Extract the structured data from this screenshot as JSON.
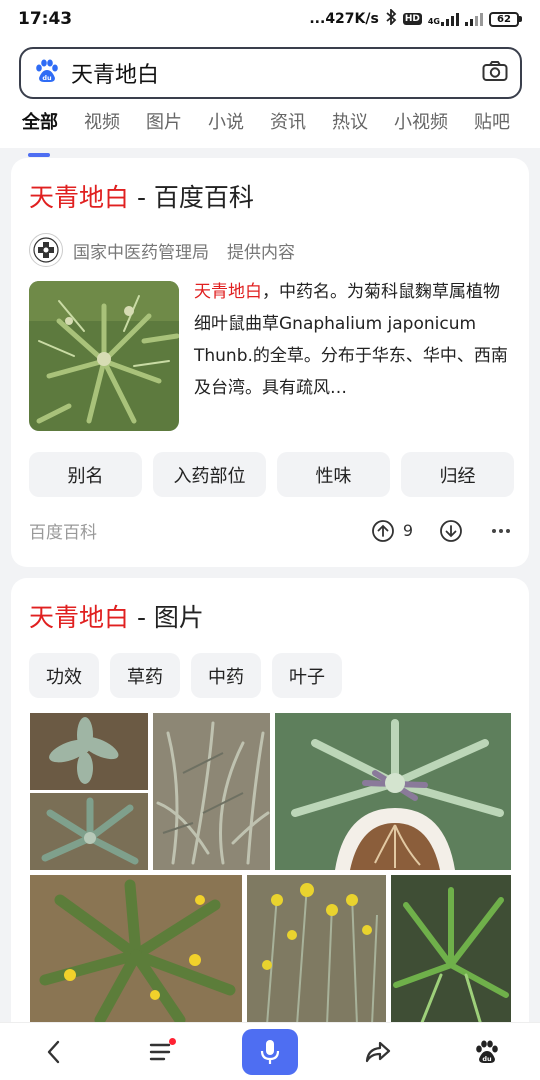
{
  "status_bar": {
    "time": "17:43",
    "net_speed": "...427K/s",
    "hd": "HD",
    "network": "4G",
    "battery": "62"
  },
  "search": {
    "query": "天青地白"
  },
  "tabs": [
    {
      "label": "全部",
      "active": true
    },
    {
      "label": "视频"
    },
    {
      "label": "图片"
    },
    {
      "label": "小说"
    },
    {
      "label": "资讯"
    },
    {
      "label": "热议"
    },
    {
      "label": "小视频"
    },
    {
      "label": "贴吧"
    }
  ],
  "baike_card": {
    "title_highlight": "天青地白",
    "title_suffix": " - 百度百科",
    "provider_name": "国家中医药管理局",
    "provider_suffix": "提供内容",
    "abstract_highlight": "天青地白",
    "abstract_text": "，中药名。为菊科鼠麴草属植物细叶鼠曲草Gnaphalium japonicum Thunb.的全草。分布于华东、华中、西南及台湾。具有疏风…",
    "chips": [
      "别名",
      "入药部位",
      "性味",
      "归经"
    ],
    "source": "百度百科",
    "upvote_count": "9"
  },
  "image_card": {
    "title_highlight": "天青地白",
    "title_suffix": " - 图片",
    "chips": [
      "功效",
      "草药",
      "中药",
      "叶子"
    ]
  },
  "colors": {
    "accent": "#4e6ef2",
    "highlight": "#e02020"
  }
}
